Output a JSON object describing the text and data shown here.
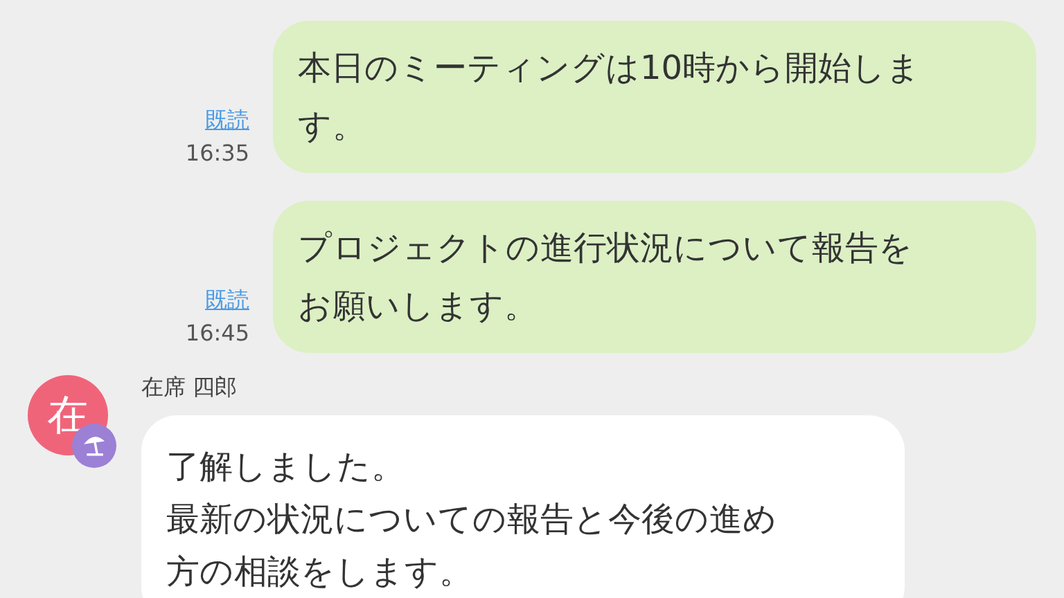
{
  "messages": [
    {
      "kind": "outgoing",
      "text": "本日のミーティングは10時から開始します。",
      "read_label": "既読",
      "time": "16:35"
    },
    {
      "kind": "outgoing",
      "text": "プロジェクトの進行状況について報告をお願いします。",
      "read_label": "既読",
      "time": "16:45"
    },
    {
      "kind": "incoming",
      "sender": "在席 四郎",
      "avatar_char": "在",
      "paragraphs": [
        "了解しました。",
        "最新の状況についての報告と今後の進め方の相談をします。"
      ]
    }
  ]
}
